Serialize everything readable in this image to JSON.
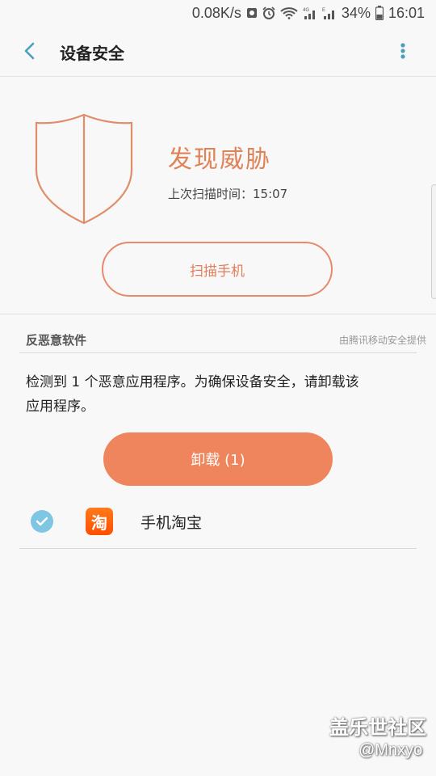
{
  "status_bar": {
    "net_speed": "0.08K/s",
    "battery": "34%",
    "time": "16:01",
    "icons": [
      "notification-icon",
      "alarm-icon",
      "wifi-icon",
      "signal-4g-icon",
      "signal-e-icon",
      "battery-icon"
    ]
  },
  "app_bar": {
    "title": "设备安全",
    "back_icon": "back-arrow-icon",
    "more_icon": "more-vertical-icon"
  },
  "status": {
    "title": "发现威胁",
    "last_scan": "上次扫描时间：15:07",
    "icon": "shield-icon"
  },
  "scan_button": {
    "label": "扫描手机"
  },
  "antimalware": {
    "section_title": "反恶意软件",
    "provider": "由腾讯移动安全提供",
    "message": "检测到 1 个恶意应用程序。为确保设备安全，请卸载该应用程序。"
  },
  "uninstall_button": {
    "label": "卸载 (1)"
  },
  "apps": [
    {
      "name": "手机淘宝",
      "icon_glyph": "淘",
      "checked": true
    }
  ],
  "watermark": {
    "title": "盖乐世社区",
    "user": "@Mnxyo"
  },
  "colors": {
    "accent": "#e08257",
    "button_fill": "#ef855d",
    "check": "#7ec6e3",
    "back_arrow": "#4a9fc0"
  }
}
